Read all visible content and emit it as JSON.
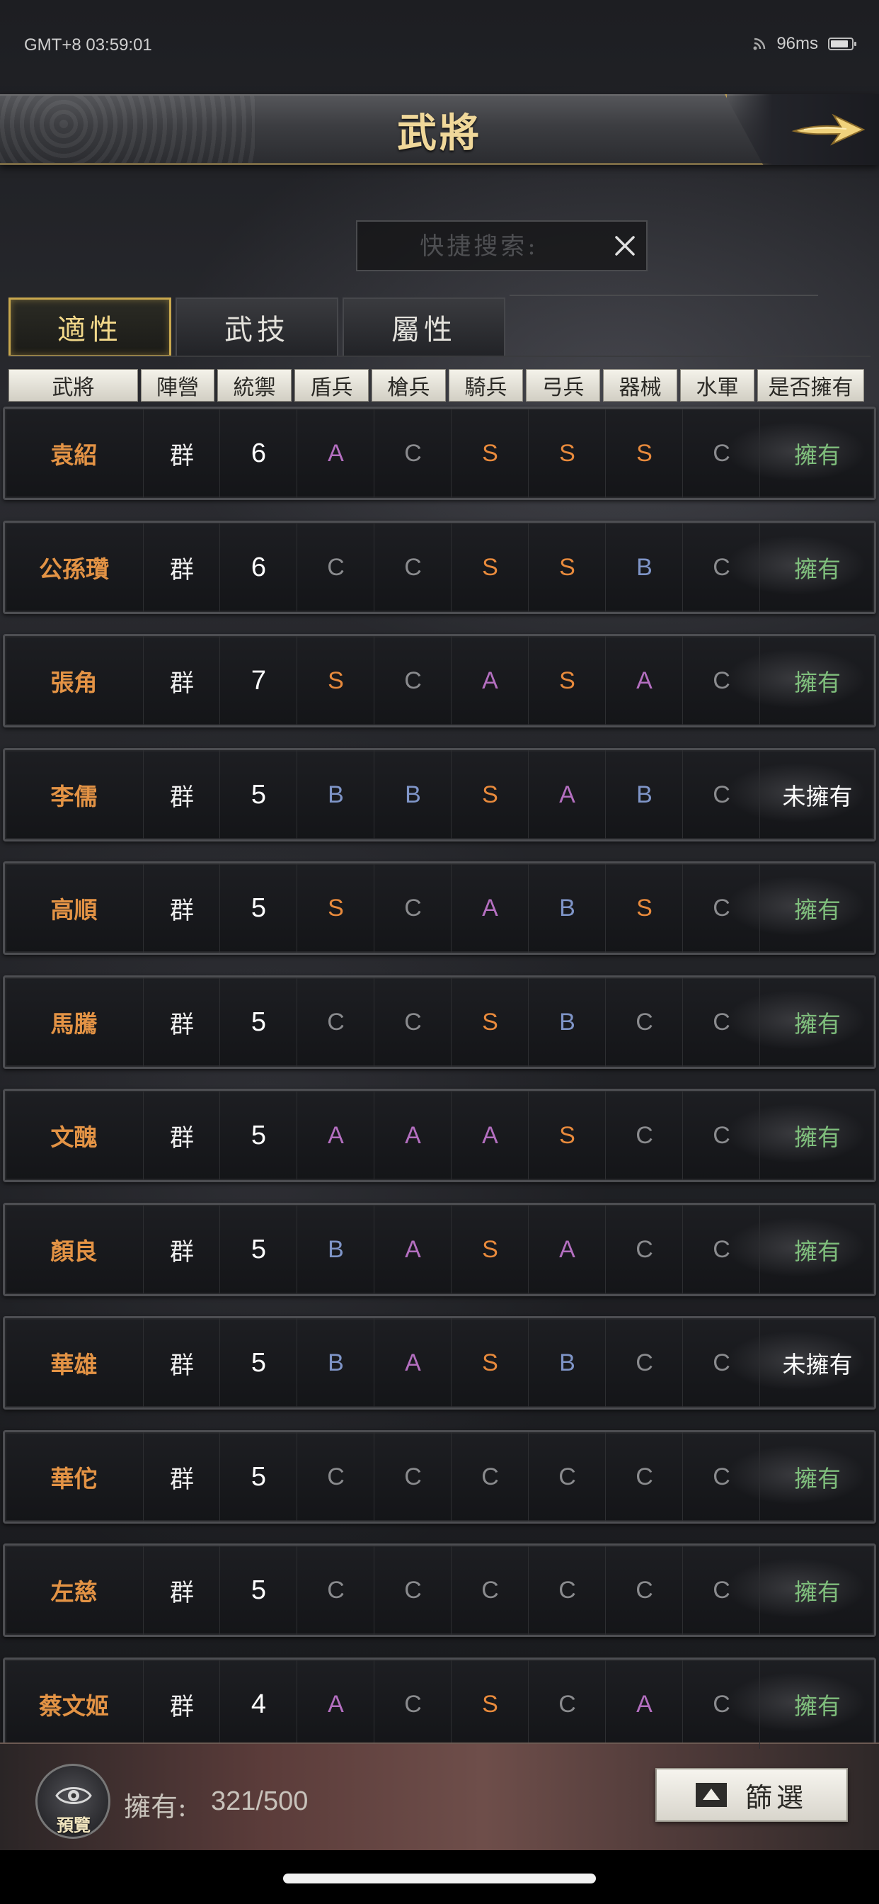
{
  "status_bar": {
    "time": "GMT+8 03:59:01",
    "ping": "96ms"
  },
  "header": {
    "title": "武將"
  },
  "search": {
    "placeholder": "快捷搜索:"
  },
  "tabs": [
    {
      "label": "適性",
      "active": true
    },
    {
      "label": "武技",
      "active": false
    },
    {
      "label": "屬性",
      "active": false
    }
  ],
  "table": {
    "columns": [
      "武將",
      "陣營",
      "統禦",
      "盾兵",
      "槍兵",
      "騎兵",
      "弓兵",
      "器械",
      "水軍",
      "是否擁有"
    ],
    "rows": [
      {
        "name": "袁紹",
        "faction": "群",
        "leadership": "6",
        "shield": "A",
        "spear": "C",
        "cavalry": "S",
        "archer": "S",
        "siege": "S",
        "navy": "C",
        "owned": "擁有"
      },
      {
        "name": "公孫瓚",
        "faction": "群",
        "leadership": "6",
        "shield": "C",
        "spear": "C",
        "cavalry": "S",
        "archer": "S",
        "siege": "B",
        "navy": "C",
        "owned": "擁有"
      },
      {
        "name": "張角",
        "faction": "群",
        "leadership": "7",
        "shield": "S",
        "spear": "C",
        "cavalry": "A",
        "archer": "S",
        "siege": "A",
        "navy": "C",
        "owned": "擁有"
      },
      {
        "name": "李儒",
        "faction": "群",
        "leadership": "5",
        "shield": "B",
        "spear": "B",
        "cavalry": "S",
        "archer": "A",
        "siege": "B",
        "navy": "C",
        "owned": "未擁有"
      },
      {
        "name": "高順",
        "faction": "群",
        "leadership": "5",
        "shield": "S",
        "spear": "C",
        "cavalry": "A",
        "archer": "B",
        "siege": "S",
        "navy": "C",
        "owned": "擁有"
      },
      {
        "name": "馬騰",
        "faction": "群",
        "leadership": "5",
        "shield": "C",
        "spear": "C",
        "cavalry": "S",
        "archer": "B",
        "siege": "C",
        "navy": "C",
        "owned": "擁有"
      },
      {
        "name": "文醜",
        "faction": "群",
        "leadership": "5",
        "shield": "A",
        "spear": "A",
        "cavalry": "A",
        "archer": "S",
        "siege": "C",
        "navy": "C",
        "owned": "擁有"
      },
      {
        "name": "顏良",
        "faction": "群",
        "leadership": "5",
        "shield": "B",
        "spear": "A",
        "cavalry": "S",
        "archer": "A",
        "siege": "C",
        "navy": "C",
        "owned": "擁有"
      },
      {
        "name": "華雄",
        "faction": "群",
        "leadership": "5",
        "shield": "B",
        "spear": "A",
        "cavalry": "S",
        "archer": "B",
        "siege": "C",
        "navy": "C",
        "owned": "未擁有"
      },
      {
        "name": "華佗",
        "faction": "群",
        "leadership": "5",
        "shield": "C",
        "spear": "C",
        "cavalry": "C",
        "archer": "C",
        "siege": "C",
        "navy": "C",
        "owned": "擁有"
      },
      {
        "name": "左慈",
        "faction": "群",
        "leadership": "5",
        "shield": "C",
        "spear": "C",
        "cavalry": "C",
        "archer": "C",
        "siege": "C",
        "navy": "C",
        "owned": "擁有"
      },
      {
        "name": "蔡文姬",
        "faction": "群",
        "leadership": "4",
        "shield": "A",
        "spear": "C",
        "cavalry": "S",
        "archer": "C",
        "siege": "A",
        "navy": "C",
        "owned": "擁有"
      }
    ]
  },
  "footer": {
    "preview_label": "預覽",
    "owned_label": "擁有:",
    "owned_value": "321/500",
    "filter_label": "篩選"
  },
  "colors": {
    "grade_S": "#e88a3c",
    "grade_A": "#b46fc0",
    "grade_B": "#7f95c8",
    "grade_C": "#8a8b8e",
    "name": "#e39345",
    "owned": "#7fbe7c",
    "accent_gold": "#c9a84e"
  }
}
